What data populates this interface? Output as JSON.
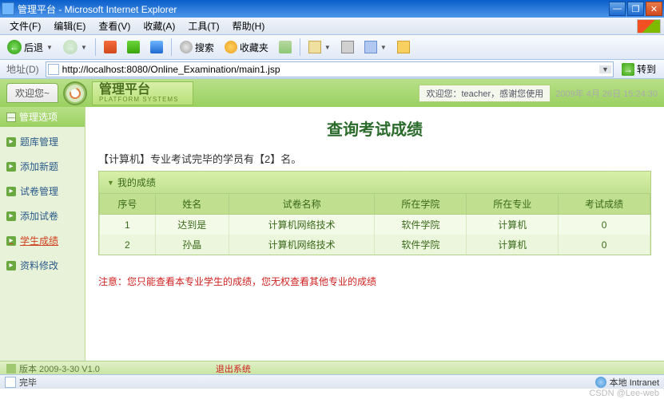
{
  "window": {
    "title": "管理平台 - Microsoft Internet Explorer"
  },
  "menu": [
    "文件(F)",
    "编辑(E)",
    "查看(V)",
    "收藏(A)",
    "工具(T)",
    "帮助(H)"
  ],
  "toolbar": {
    "back": "后退",
    "search": "搜索",
    "favorites": "收藏夹"
  },
  "addressbar": {
    "label": "地址(D)",
    "url": "http://localhost:8080/Online_Examination/main1.jsp",
    "go": "转到"
  },
  "header": {
    "welcome": "欢迎您~",
    "brand": "管理平台",
    "brand_sub": "PLATFORM SYSTEMS",
    "greet": "欢迎您：teacher，感谢您使用",
    "date": "2009年 4月 26日 15:24:30"
  },
  "sidebar": {
    "header": "管理选项",
    "items": [
      {
        "label": "题库管理"
      },
      {
        "label": "添加新题"
      },
      {
        "label": "试卷管理"
      },
      {
        "label": "添加试卷"
      },
      {
        "label": "学生成绩"
      },
      {
        "label": "资料修改"
      }
    ],
    "active_index": 4
  },
  "content": {
    "title": "查询考试成绩",
    "info": "【计算机】专业考试完毕的学员有【2】名。",
    "box_title": "我的成绩",
    "columns": [
      "序号",
      "姓名",
      "试卷名称",
      "所在学院",
      "所在专业",
      "考试成绩"
    ],
    "rows": [
      [
        "1",
        "达到是",
        "计算机网络技术",
        "软件学院",
        "计算机",
        "0"
      ],
      [
        "2",
        "孙晶",
        "计算机网络技术",
        "软件学院",
        "计算机",
        "0"
      ]
    ],
    "notice": "注意：您只能查看本专业学生的成绩，您无权查看其他专业的成绩"
  },
  "footer": {
    "version": "版本 2009-3-30 V1.0",
    "logout": "退出系统"
  },
  "status": {
    "done": "完毕",
    "zone": "本地 Intranet"
  },
  "watermark": "CSDN @Lee-web"
}
